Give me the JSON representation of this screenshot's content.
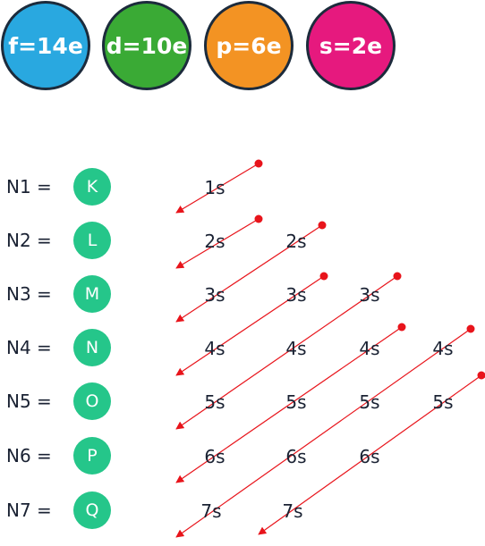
{
  "capacities": [
    {
      "label": "f=14e",
      "color": "#29a8e0"
    },
    {
      "label": "d=10e",
      "color": "#3aaa35"
    },
    {
      "label": "p=6e",
      "color": "#f39323"
    },
    {
      "label": "s=2e",
      "color": "#e6197e"
    }
  ],
  "shell_color": "#25c68a",
  "arrow_color": "#e8141b",
  "rows": [
    {
      "label": "N1 =",
      "shell": "K",
      "orbitals": [
        "1s"
      ]
    },
    {
      "label": "N2 =",
      "shell": "L",
      "orbitals": [
        "2s",
        "2s"
      ]
    },
    {
      "label": "N3 =",
      "shell": "M",
      "orbitals": [
        "3s",
        "3s",
        "3s"
      ]
    },
    {
      "label": "N4 =",
      "shell": "N",
      "orbitals": [
        "4s",
        "4s",
        "4s",
        "4s"
      ]
    },
    {
      "label": "N5 =",
      "shell": "O",
      "orbitals": [
        "5s",
        "5s",
        "5s",
        "5s"
      ]
    },
    {
      "label": "N6 =",
      "shell": "P",
      "orbitals": [
        "6s",
        "6s",
        "6s"
      ]
    },
    {
      "label": "N7 =",
      "shell": "Q",
      "orbitals": [
        "7s",
        "7s"
      ]
    }
  ]
}
